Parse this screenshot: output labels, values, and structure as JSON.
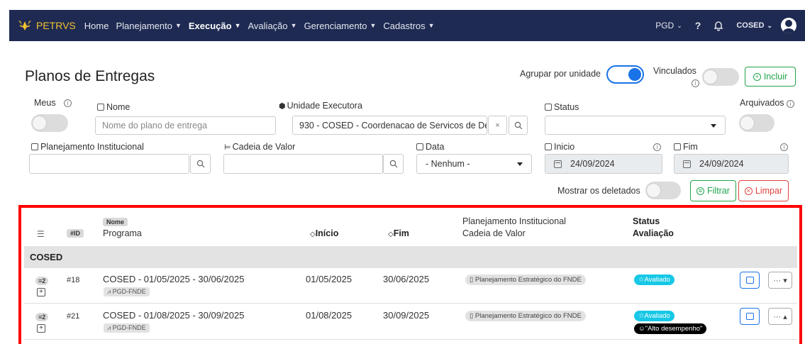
{
  "navbar": {
    "brand": "PETRVS",
    "menu": [
      {
        "label": "Home",
        "caret": false,
        "active": false
      },
      {
        "label": "Planejamento",
        "caret": true,
        "active": false
      },
      {
        "label": "Execução",
        "caret": true,
        "active": true
      },
      {
        "label": "Avaliação",
        "caret": true,
        "active": false
      },
      {
        "label": "Gerenciamento",
        "caret": true,
        "active": false
      },
      {
        "label": "Cadastros",
        "caret": true,
        "active": false
      }
    ],
    "right": {
      "pgd": "PGD",
      "help": "?",
      "user": "COSED"
    }
  },
  "page": {
    "title": "Planos de Entregas"
  },
  "header": {
    "agrupar_label": "Agrupar por unidade",
    "agrupar_on": true,
    "vinculados_label": "Vinculados",
    "vinculados_on": false,
    "incluir_label": "Incluir"
  },
  "filters": {
    "meus_label": "Meus",
    "nome_label": "Nome",
    "nome_placeholder": "Nome do plano de entrega",
    "unidade_label": "Unidade Executora",
    "unidade_value": "930 - COSED - Coordenacao de Servicos de De",
    "unidade_clear": "×",
    "status_label": "Status",
    "status_value": "",
    "arquivados_label": "Arquivados",
    "planejamento_label": "Planejamento Institucional",
    "cadeia_label": "Cadeia de Valor",
    "data_label": "Data",
    "data_value": "- Nenhum -",
    "inicio_label": "Inicio",
    "inicio_value": "24/09/2024",
    "fim_label": "Fim",
    "fim_value": "24/09/2024",
    "deletados_label": "Mostrar os deletados",
    "filtrar_label": "Filtrar",
    "limpar_label": "Limpar"
  },
  "table": {
    "headers": {
      "id": "#ID",
      "nome_tag": "Nome",
      "programa": "Programa",
      "inicio": "Início",
      "fim": "Fim",
      "planejamento": "Planejamento Institucional",
      "cadeia": "Cadeia de Valor",
      "status": "Status",
      "avaliacao": "Avaliação"
    },
    "group": "COSED",
    "rows": [
      {
        "count": "2",
        "id": "#18",
        "nome": "COSED - 01/05/2025 - 30/06/2025",
        "programa": "PGD-FNDE",
        "inicio": "01/05/2025",
        "fim": "30/06/2025",
        "planejamento": "Planejamento Estratégico do FNDE",
        "status": "Avaliado",
        "avaliacao": "",
        "more": "··· ▾"
      },
      {
        "count": "2",
        "id": "#21",
        "nome": "COSED - 01/08/2025 - 30/09/2025",
        "programa": "PGD-FNDE",
        "inicio": "01/08/2025",
        "fim": "30/09/2025",
        "planejamento": "Planejamento Estratégico do FNDE",
        "status": "Avaliado",
        "avaliacao": "\"Alto desempenho\"",
        "more": "··· ▴"
      }
    ]
  }
}
